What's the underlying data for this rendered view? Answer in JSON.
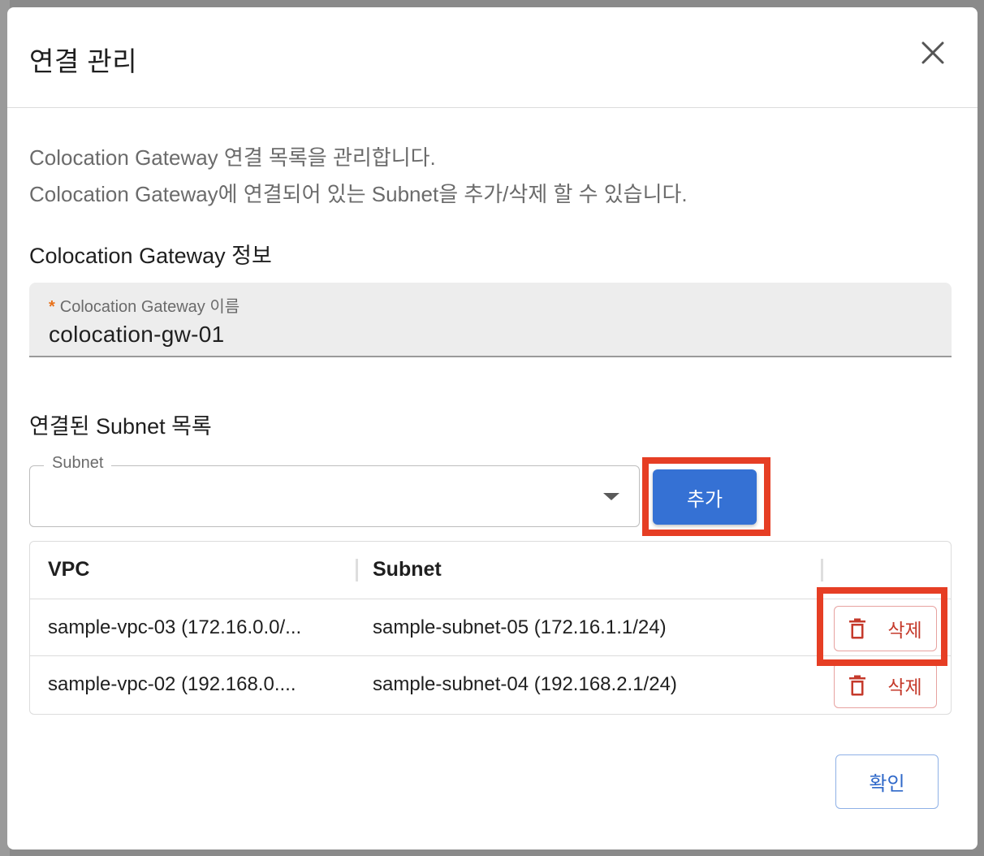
{
  "dialog": {
    "title": "연결 관리",
    "description_line1": "Colocation Gateway 연결 목록을 관리합니다.",
    "description_line2": "Colocation Gateway에 연결되어 있는 Subnet을 추가/삭제 할 수 있습니다."
  },
  "gateway_info": {
    "section_title": "Colocation Gateway 정보",
    "name_field": {
      "required_mark": "*",
      "label": "Colocation Gateway 이름",
      "value": "colocation-gw-01"
    }
  },
  "subnet_list": {
    "section_title": "연결된 Subnet 목록",
    "select": {
      "label": "Subnet",
      "value": ""
    },
    "add_button": "추가",
    "table": {
      "columns": [
        "VPC",
        "Subnet",
        ""
      ],
      "rows": [
        {
          "vpc": "sample-vpc-03 (172.16.0.0/...",
          "subnet": "sample-subnet-05 (172.16.1.1/24)",
          "action": "삭제"
        },
        {
          "vpc": "sample-vpc-02 (192.168.0....",
          "subnet": "sample-subnet-04 (192.168.2.1/24)",
          "action": "삭제"
        }
      ]
    }
  },
  "footer": {
    "confirm_button": "확인"
  },
  "icons": {
    "close": "close-icon",
    "delete": "trash-icon",
    "select": "caret-down-icon"
  },
  "colors": {
    "primary": "#3571d4",
    "danger": "#c53a2b",
    "highlight": "#e63e24",
    "required": "#e8711a"
  }
}
